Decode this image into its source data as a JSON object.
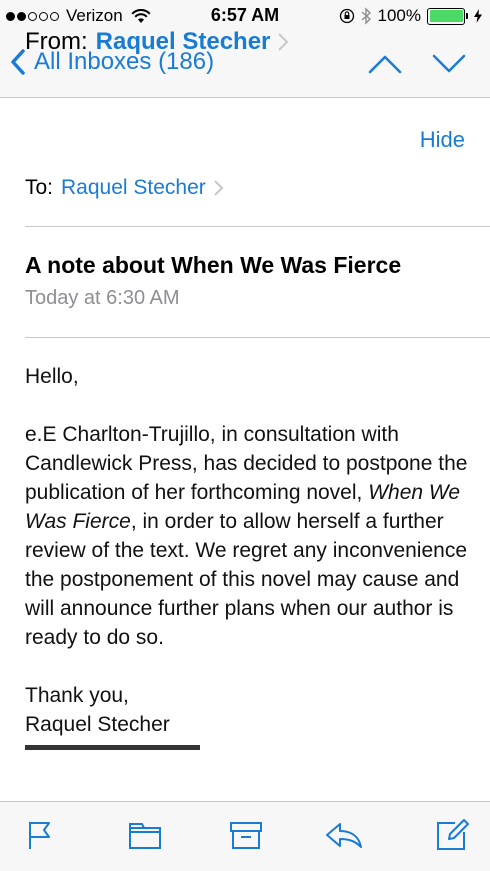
{
  "status_bar": {
    "carrier": "Verizon",
    "time": "6:57 AM",
    "battery": "100%",
    "signal_bars_filled": 2,
    "signal_bars_total": 5,
    "battery_level": 1.0,
    "battery_color": "#4cd964"
  },
  "nav": {
    "back_label": "All Inboxes (186)",
    "accent_color": "#1a7bd5",
    "icons": [
      "chevron-left-icon",
      "previous-message-icon",
      "next-message-icon"
    ]
  },
  "header": {
    "from_label": "From:",
    "from_name": "Raquel Stecher",
    "hide_label": "Hide",
    "to_label": "To:",
    "to_name": "Raquel Stecher",
    "subject": "A note about When We Was Fierce",
    "date": "Today at 6:30 AM"
  },
  "body": {
    "greeting": "Hello,",
    "para_a": "e.E Charlton-Trujillo, in consultation with Candlewick Press, has decided to postpone the publication of her forthcoming novel,  ",
    "para_title": "When We Was Fierce",
    "para_b": ", in order to allow herself a further review of the text.  We regret any inconvenience the postponement of this novel may cause and will announce further plans when our author is ready to do so.",
    "closing": "Thank you,",
    "signature": "Raquel Stecher"
  },
  "toolbar": {
    "icons": [
      "flag-icon",
      "folder-icon",
      "archive-icon",
      "reply-icon",
      "compose-icon"
    ]
  }
}
